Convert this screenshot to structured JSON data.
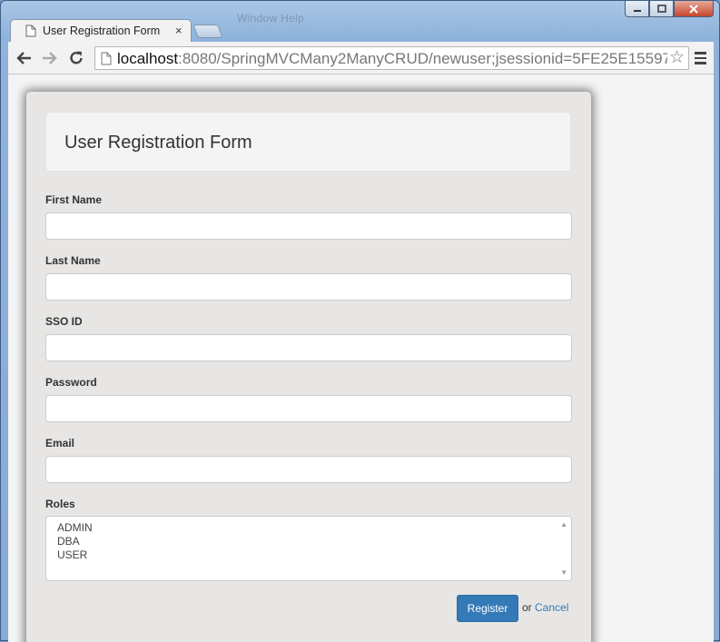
{
  "window": {
    "ghost_menu": "Window  Help"
  },
  "tab": {
    "title": "User Registration Form",
    "close_glyph": "×"
  },
  "address_bar": {
    "host": "localhost",
    "path": ":8080/SpringMVCMany2ManyCRUD/newuser;jsessionid=5FE25E15597",
    "star_glyph": "☆"
  },
  "form": {
    "title": "User Registration Form",
    "fields": [
      {
        "label": "First Name",
        "value": ""
      },
      {
        "label": "Last Name",
        "value": ""
      },
      {
        "label": "SSO ID",
        "value": ""
      },
      {
        "label": "Password",
        "value": ""
      },
      {
        "label": "Email",
        "value": ""
      }
    ],
    "roles_label": "Roles",
    "roles": [
      "ADMIN",
      "DBA",
      "USER"
    ],
    "register_label": "Register",
    "or_text": "or",
    "cancel_label": "Cancel"
  },
  "colors": {
    "primary": "#337ab7",
    "card": "#e8e6e4"
  },
  "icons": {
    "back": "back-arrow-icon",
    "forward": "forward-arrow-icon",
    "reload": "reload-icon",
    "page": "page-icon",
    "star": "bookmark-star-icon",
    "menu": "hamburger-menu-icon"
  }
}
